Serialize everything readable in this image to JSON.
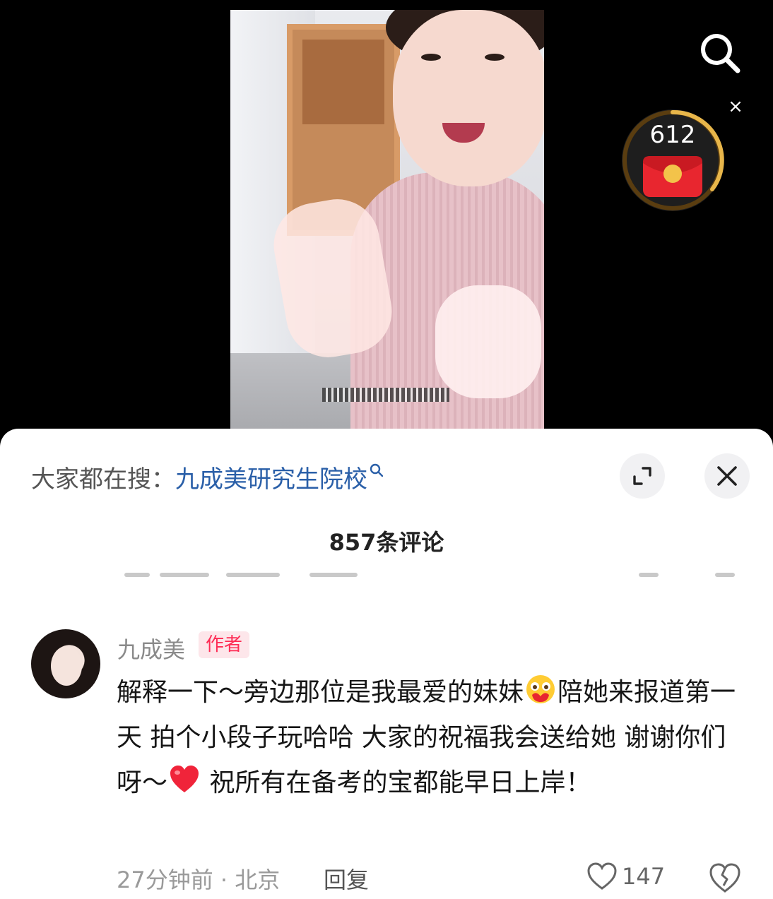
{
  "overlay": {
    "redpack_count": "612",
    "close_label": "×"
  },
  "hot_search": {
    "prefix": "大家都在搜：",
    "term": "九成美研究生院校"
  },
  "comments_header": {
    "count_label": "857条评论"
  },
  "comment": {
    "author": "九成美",
    "badge": "作者",
    "text_1": "解释一下～旁边那位是我最爱的妹妹",
    "text_2": "陪她来报道第一天 拍个小段子玩哈哈 大家的祝福我会送给她 谢谢你们呀～",
    "text_3": " 祝所有在备考的宝都能早日上岸！",
    "time_location": "27分钟前 · 北京",
    "reply_label": "回复",
    "like_count": "147"
  },
  "colors": {
    "accent_red": "#fe2c55",
    "link_blue": "#2a5fa8"
  },
  "icons": [
    "search-icon",
    "close-icon",
    "red-packet-icon",
    "expand-icon",
    "heart-icon",
    "broken-heart-icon",
    "blush-emoji",
    "red-heart-emoji"
  ]
}
